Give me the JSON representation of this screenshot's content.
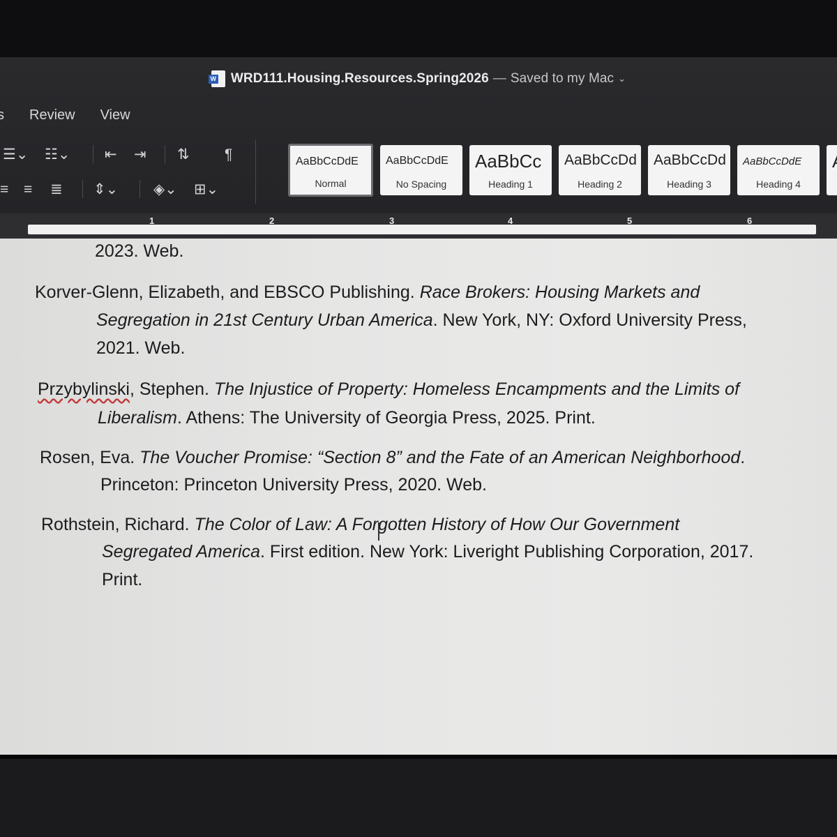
{
  "window": {
    "doc_name": "WRD111.Housing.Resources.Spring2026",
    "separator": "—",
    "save_status": "Saved to my Mac",
    "chevron": "⌄"
  },
  "tabs": {
    "partial": "s",
    "review": "Review",
    "view": "View"
  },
  "styles": [
    {
      "sample": "AaBbCcDdE",
      "name": "Normal"
    },
    {
      "sample": "AaBbCcDdE",
      "name": "No Spacing"
    },
    {
      "sample": "AaBbCc",
      "name": "Heading 1"
    },
    {
      "sample": "AaBbCcDd",
      "name": "Heading 2"
    },
    {
      "sample": "AaBbCcDd",
      "name": "Heading 3"
    },
    {
      "sample": "AaBbCcDdE",
      "name": "Heading 4"
    },
    {
      "sample": "A",
      "name": ""
    }
  ],
  "ruler": {
    "n1": "1",
    "n2": "2",
    "n3": "3",
    "n4": "4",
    "n5": "5",
    "n6": "6"
  },
  "entries": {
    "e0_line": "2023. Web.",
    "e1_a": "Korver-Glenn, Elizabeth, and EBSCO Publishing. ",
    "e1_title1": "Race Brokers: Housing Markets and",
    "e1_title2": "Segregation in 21st Century Urban America",
    "e1_b": ". New York, NY: Oxford University Press,",
    "e1_c": "2021. Web.",
    "e2_author1": "Przybylinski",
    "e2_author2": ", Stephen. ",
    "e2_title1": "The Injustice of Property: Homeless Encampments and the Limits of",
    "e2_title2": "Liberalism",
    "e2_b": ". Athens: The University of Georgia Press, 2025. Print.",
    "e3_a": "Rosen, Eva. ",
    "e3_title": "The Voucher Promise: “Section 8” and the Fate of an American Neighborhood",
    "e3_dot": ".",
    "e3_b": "Princeton: Princeton University Press, 2020. Web.",
    "e4_a": "Rothstein, Richard. ",
    "e4_title1": "The Color of Law: A Forgotten History of How Our Government",
    "e4_title2": "Segregated America",
    "e4_b": ". First edition. New York: Liveright Publishing Corporation, 2017.",
    "e4_c": "Print."
  }
}
